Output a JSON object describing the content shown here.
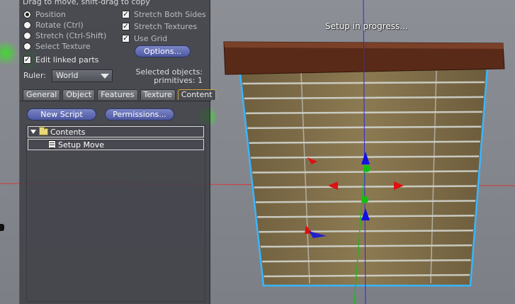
{
  "viewport": {
    "status_text": "Setup in progress..."
  },
  "build_tool": {
    "hint": "Drag to move, shift-drag to copy",
    "modes": [
      {
        "label": "Position",
        "selected": true
      },
      {
        "label": "Rotate (Ctrl)",
        "selected": false
      },
      {
        "label": "Stretch (Ctrl-Shift)",
        "selected": false
      },
      {
        "label": "Select Texture",
        "selected": false
      }
    ],
    "edit_linked": {
      "label": "Edit linked parts",
      "checked": true
    },
    "options": [
      {
        "label": "Stretch Both Sides",
        "checked": true
      },
      {
        "label": "Stretch Textures",
        "checked": true
      },
      {
        "label": "Use Grid",
        "checked": true
      }
    ],
    "options_button": "Options...",
    "ruler": {
      "label": "Ruler:",
      "value": "World"
    },
    "selection": {
      "line1": "Selected objects:",
      "line2": "primitives: 1"
    },
    "tabs": [
      {
        "label": "General",
        "active": false
      },
      {
        "label": "Object",
        "active": false
      },
      {
        "label": "Features",
        "active": false
      },
      {
        "label": "Texture",
        "active": false
      },
      {
        "label": "Content",
        "active": true
      }
    ],
    "content": {
      "new_script_button": "New Script",
      "permissions_button": "Permissions...",
      "items": [
        {
          "label": "Contents",
          "icon": "folder-icon"
        },
        {
          "label": "Setup Move",
          "icon": "script-icon"
        }
      ]
    }
  },
  "colors": {
    "selection_outline": "#38b6ff",
    "axis_x": "#e01010",
    "axis_y": "#1010e0",
    "axis_z": "#00c000",
    "button_blue": "#5c67ad"
  }
}
